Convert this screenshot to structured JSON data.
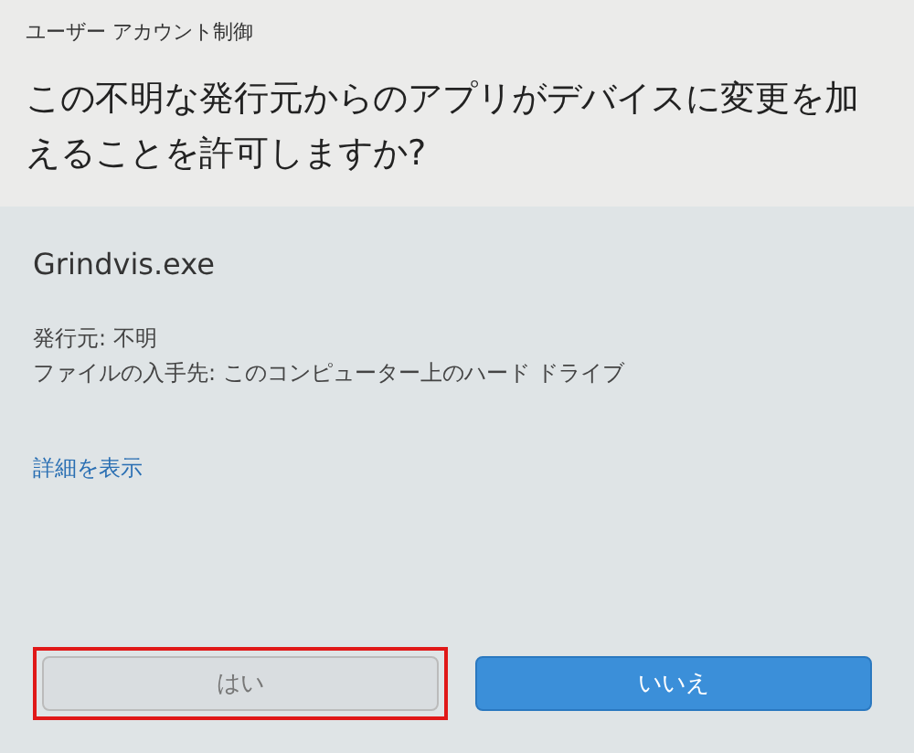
{
  "window": {
    "title": "ユーザー アカウント制御"
  },
  "question": "この不明な発行元からのアプリがデバイスに変更を加えることを許可しますか?",
  "app_name": "Grindvis.exe",
  "details": [
    "発行元: 不明",
    "ファイルの入手先: このコンピューター上のハード ドライブ"
  ],
  "more_link": "詳細を表示",
  "buttons": [
    {
      "label": "はい",
      "kind": "secondary",
      "highlighted": true
    },
    {
      "label": "いいえ",
      "kind": "primary",
      "highlighted": false
    }
  ]
}
